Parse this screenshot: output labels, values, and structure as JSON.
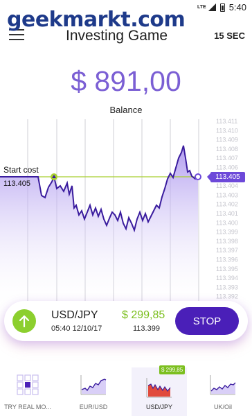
{
  "status_bar": {
    "network": "LTE",
    "time": "5:40"
  },
  "watermark": "geekmarkt.com",
  "header": {
    "title": "Investing Game",
    "timer": "15 SEC"
  },
  "balance": {
    "value": "$ 891,00",
    "label": "Balance"
  },
  "chart": {
    "start_cost_label": "Start cost",
    "start_cost_value": "113.405",
    "current_price": "113.405",
    "y_ticks": [
      "113.411",
      "113.410",
      "113.409",
      "113.408",
      "113.407",
      "113.406",
      "113.405",
      "113.404",
      "113.403",
      "113.402",
      "113.401",
      "113.400",
      "113.399",
      "113.398",
      "113.397",
      "113.396",
      "113.395",
      "113.394",
      "113.393",
      "113.392"
    ],
    "colors": {
      "line": "#3a1c9e",
      "fill": "#b9a6f0",
      "start_line": "#a8cf2e",
      "badge": "#6d49d9"
    }
  },
  "trade": {
    "pair": "USD/JPY",
    "time": "05:40 12/10/17",
    "profit": "$ 299,85",
    "rate": "113.399",
    "stop_label": "STOP",
    "arrow_icon": "arrow-up-icon",
    "colors": {
      "arrow": "#8ccf2e",
      "profit": "#7cbf1f",
      "stop": "#4a1fb8"
    }
  },
  "tabs": [
    {
      "label": "TRY REAL MO...",
      "icon": "grid-icon",
      "active": false
    },
    {
      "label": "EUR/USD",
      "icon": "line-chart-icon",
      "active": false
    },
    {
      "label": "USD/JPY",
      "icon": "bar-chart-icon",
      "active": true,
      "badge": "$ 299,85"
    },
    {
      "label": "UK/Oil",
      "icon": "line-chart-icon",
      "active": false
    }
  ]
}
